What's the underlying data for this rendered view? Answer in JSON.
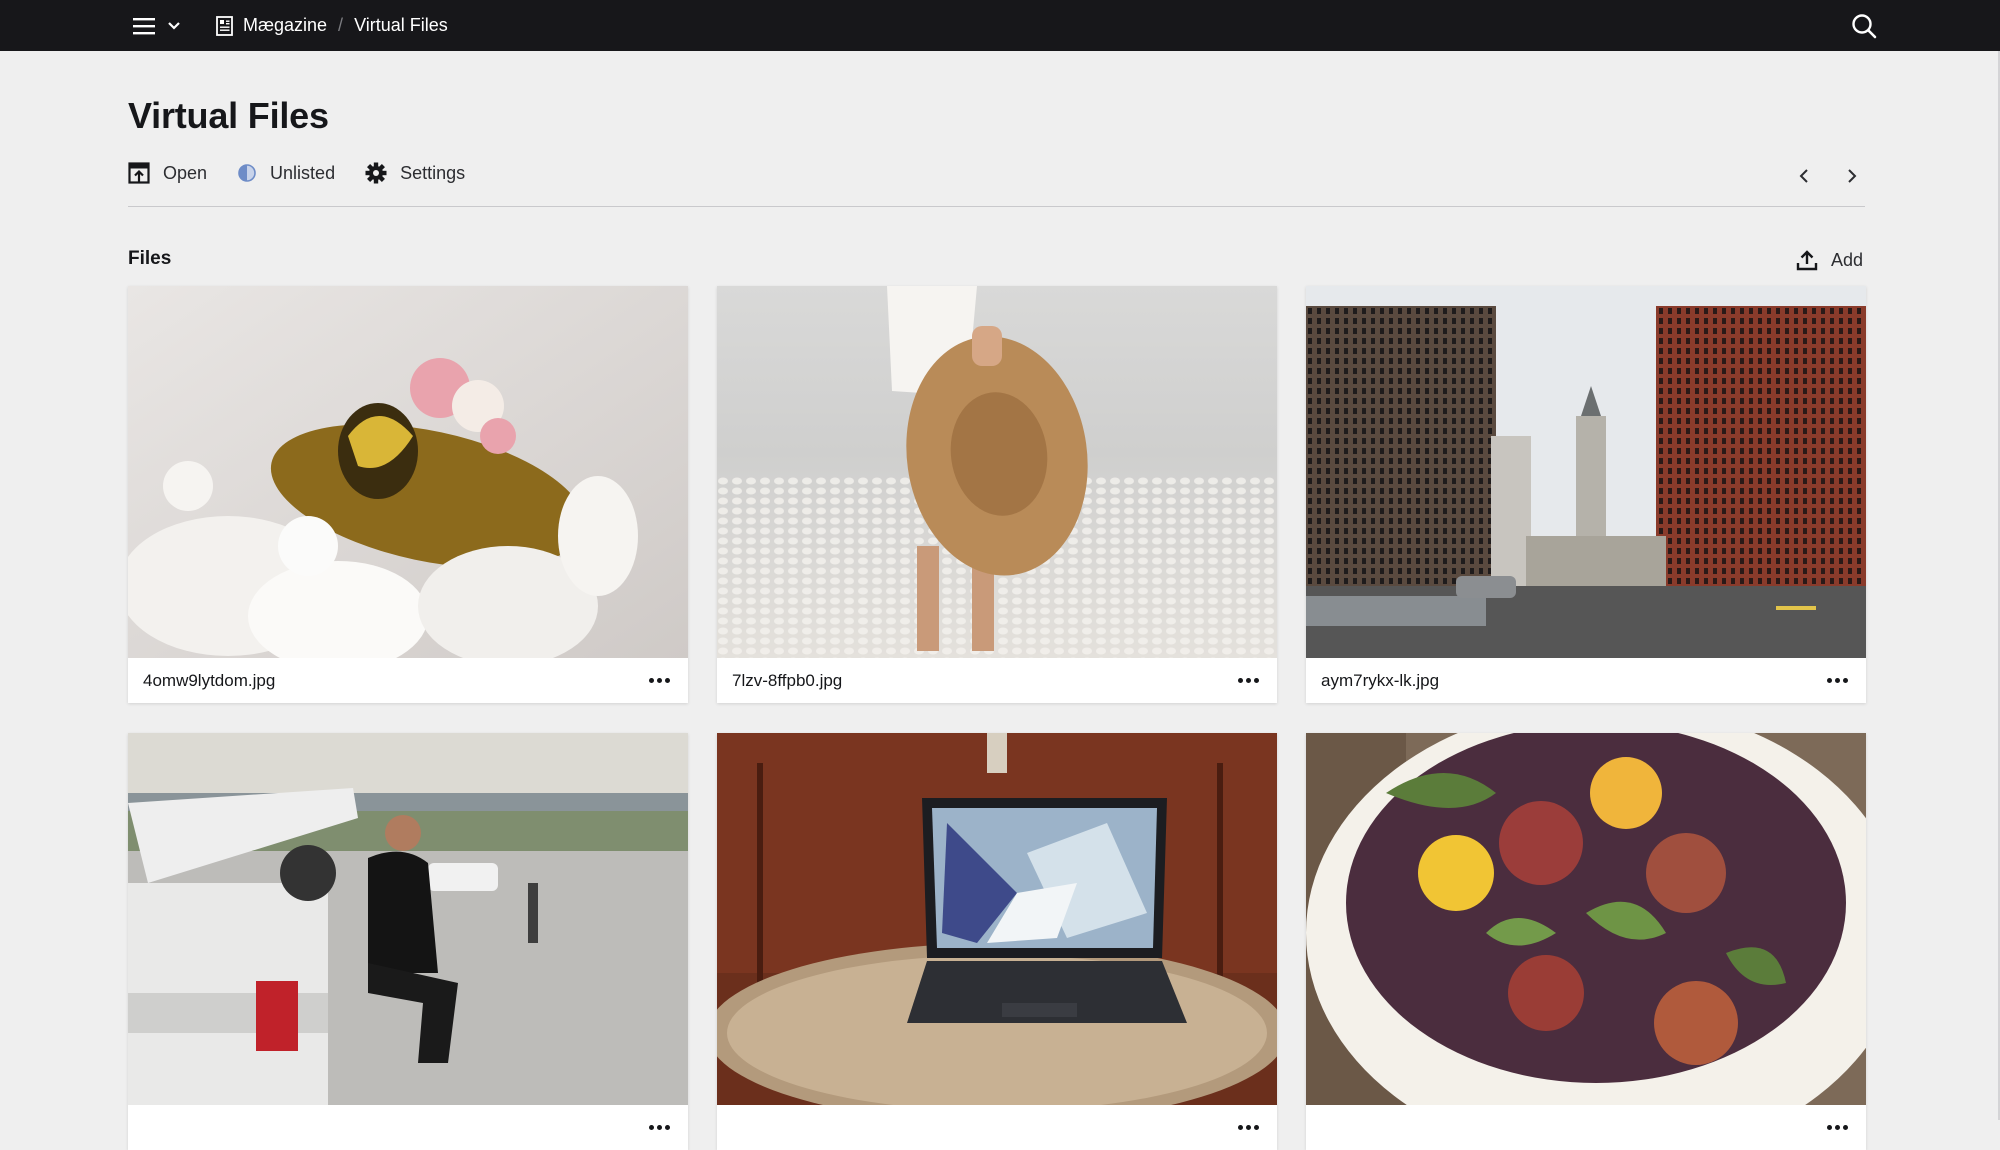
{
  "topbar": {
    "menu_icon": "hamburger-icon",
    "dropdown_icon": "chevron-down-icon",
    "breadcrumbs": [
      {
        "label": "Mægazine",
        "icon": "document-icon"
      },
      {
        "label": "Virtual Files"
      }
    ],
    "separator": "/",
    "search_icon": "search-icon"
  },
  "page": {
    "title": "Virtual Files",
    "tabs": [
      {
        "label": "Open",
        "icon": "open-preview-icon"
      },
      {
        "label": "Unlisted",
        "icon": "half-circle-icon"
      },
      {
        "label": "Settings",
        "icon": "gear-icon"
      }
    ],
    "pager": {
      "prev_icon": "chevron-left-icon",
      "next_icon": "chevron-right-icon"
    }
  },
  "files_section": {
    "title": "Files",
    "add_label": "Add",
    "add_icon": "upload-icon",
    "files": [
      {
        "name": "4omw9lytdom.jpg",
        "thumbnail": "turtle-with-flowers"
      },
      {
        "name": "7lzv-8ffpb0.jpg",
        "thumbnail": "woman-holding-straw-hat"
      },
      {
        "name": "aym7rykx-lk.jpg",
        "thumbnail": "city-street-with-city-hall"
      },
      {
        "name": "",
        "thumbnail": "man-on-truck-tailgate"
      },
      {
        "name": "",
        "thumbnail": "laptop-on-table"
      },
      {
        "name": "",
        "thumbnail": "salad-plate"
      }
    ],
    "more_icon": "more-dots-icon"
  },
  "colors": {
    "topbar_bg": "#17171a",
    "page_bg": "#efefef",
    "accent_unlisted": "#6e8cc7"
  }
}
